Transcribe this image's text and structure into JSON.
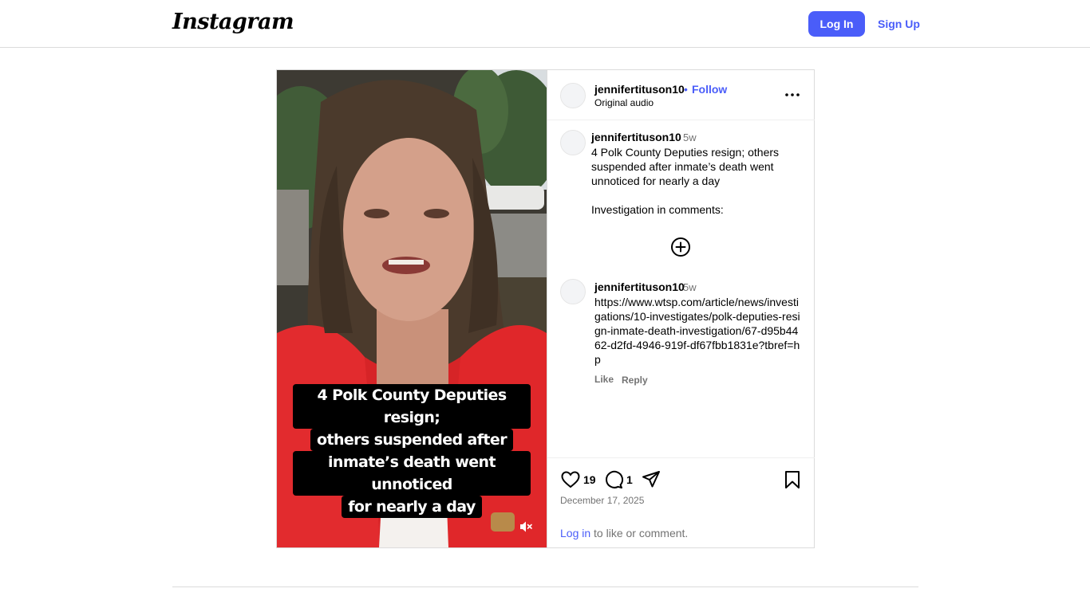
{
  "header": {
    "logo_text": "Instagram",
    "login_label": "Log In",
    "signup_label": "Sign Up"
  },
  "post": {
    "username": "jennifertituson10",
    "separator": "•",
    "follow_label": "Follow",
    "audio_label": "Original audio",
    "video_caption_lines": [
      "4 Polk County Deputies resign;",
      "others suspended after",
      "inmate’s death went unnoticed",
      "for nearly a day"
    ],
    "caption": {
      "username": "jennifertituson10",
      "time": "5w",
      "text": "4 Polk County Deputies resign; others suspended after inmate’s death went unnoticed for nearly a day\n\nInvestigation in comments:"
    },
    "comments": [
      {
        "username": "jennifertituson10",
        "time": "5w",
        "text": "https://www.wtsp.com/article/news/investigations/10-investigates/polk-deputies-resign-inmate-death-investigation/67-d95b4462-d2fd-4946-919f-df67fbb1831e?tbref=hp",
        "like_label": "Like",
        "reply_label": "Reply"
      }
    ],
    "likes": "19",
    "comment_count": "1",
    "date": "December 17, 2025",
    "login_prompt_link": "Log in",
    "login_prompt_rest": " to like or comment."
  },
  "colors": {
    "accent": "#4a5df9",
    "muted": "#737373",
    "border": "#dbdbdb"
  },
  "icons": [
    "more-horizontal-icon",
    "add-circle-icon",
    "heart-icon",
    "comment-icon",
    "share-icon",
    "bookmark-icon",
    "mute-icon"
  ]
}
